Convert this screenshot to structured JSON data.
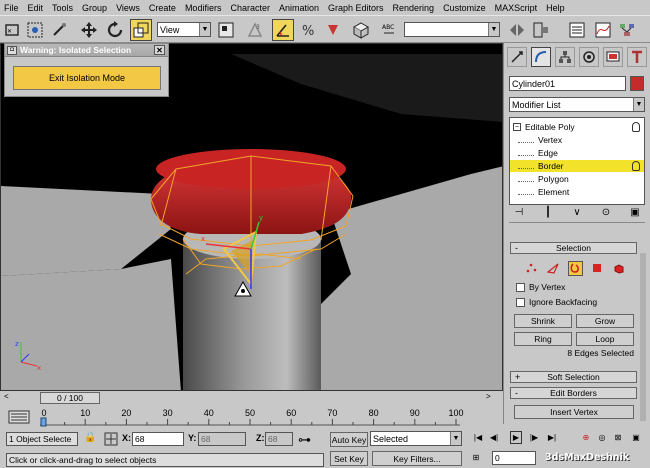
{
  "menu": [
    "File",
    "Edit",
    "Tools",
    "Group",
    "Views",
    "Create",
    "Modifiers",
    "Character",
    "Animation",
    "Graph Editors",
    "Rendering",
    "Customize",
    "MAXScript",
    "Help"
  ],
  "toolbar": {
    "view_combo": "View"
  },
  "dialog": {
    "title": "Warning: Isolated Selection",
    "close": "✕",
    "exit_button": "Exit Isolation Mode"
  },
  "panel": {
    "object_name": "Cylinder01",
    "object_color": "#c62b2b",
    "modifier_list": "Modifier List",
    "stack": {
      "base": "Editable Poly",
      "subobjects": [
        "Vertex",
        "Edge",
        "Border",
        "Polygon",
        "Element"
      ],
      "selected": "Border"
    },
    "selection_rollout": "Selection",
    "by_vertex": "By Vertex",
    "ignore_backfacing": "Ignore Backfacing",
    "shrink": "Shrink",
    "grow": "Grow",
    "ring": "Ring",
    "loop": "Loop",
    "status": "8 Edges Selected",
    "soft_selection": "Soft Selection",
    "edit_borders": "Edit Borders",
    "insert_vertex": "Insert Vertex",
    "rollout_plus": "+",
    "rollout_minus": "-"
  },
  "timeline": {
    "frame": "0 / 100",
    "ticks": [
      "0",
      "10",
      "20",
      "30",
      "40",
      "50",
      "60",
      "70",
      "80",
      "90",
      "100"
    ]
  },
  "status": {
    "selected_count": "1 Object Selecte",
    "x_label": "X:",
    "x_value": "68",
    "y_label": "Y:",
    "y_value": "68",
    "z_label": "Z:",
    "z_value": "68",
    "prompt": "Click or click-and-drag to select objects",
    "auto_key": "Auto Key",
    "set_key": "Set Key",
    "key_mode": "Selected",
    "key_filters": "Key Filters...",
    "frame_field": "0"
  },
  "watermark": "3dsMaxDeshnik",
  "colors": {
    "accent": "#f2c845",
    "highlight": "#f2e32a"
  }
}
